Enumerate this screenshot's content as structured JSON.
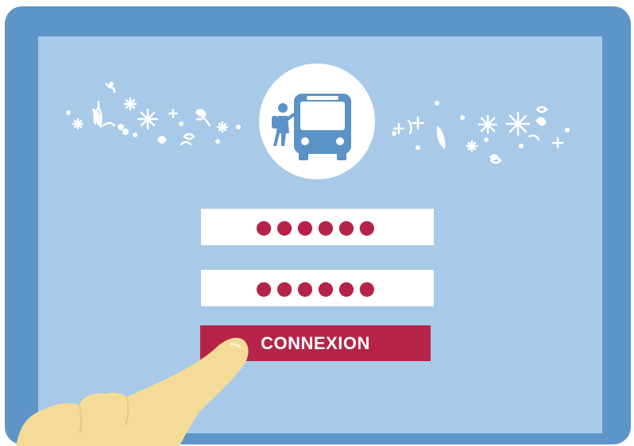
{
  "colors": {
    "device_frame": "#5e95c8",
    "screen_background": "#a8c9e8",
    "accent": "#b52448",
    "field_background": "#ffffff",
    "icon_blue": "#5b93c6",
    "finger_skin": "#f4dc98"
  },
  "logo": {
    "icon": "bus-with-hiker-icon"
  },
  "decorations": {
    "left_icon": "snowflake-ornament-icon",
    "right_icon": "snowflake-ornament-icon"
  },
  "login_form": {
    "username_field": {
      "masked_value": "●●●●●●"
    },
    "password_field": {
      "masked_value": "●●●●●●"
    },
    "submit_button": {
      "label": "CONNEXION"
    }
  },
  "pointer": {
    "icon": "pointing-finger-icon"
  }
}
